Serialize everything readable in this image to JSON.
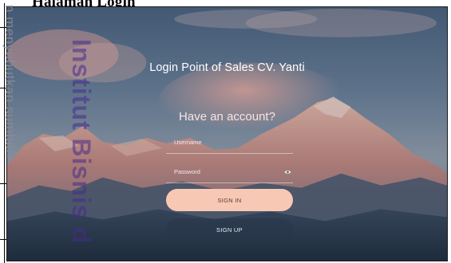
{
  "caption": "Halaman Login",
  "watermarks": {
    "institution": "Institut Bisnis d",
    "margin": "n menyebutkan sumber:"
  },
  "login": {
    "title": "Login Point of Sales CV. Yanti",
    "subtitle": "Have an account?",
    "username_label": "Username",
    "password_label": "Password",
    "signin_label": "SIGN IN",
    "signup_label": "SIGN UP"
  },
  "icons": {
    "password_toggle": "eye-icon"
  },
  "colors": {
    "signin_button": "#f7c9b5",
    "signin_text": "#5a3a33",
    "signup_button": "#283748",
    "title_text": "#ffffff"
  }
}
